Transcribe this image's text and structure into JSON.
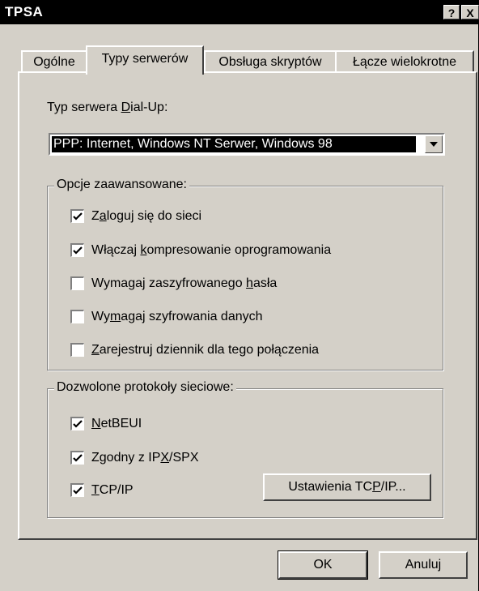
{
  "window": {
    "title": "TPSA",
    "help_label": "?",
    "close_label": "X"
  },
  "tabs": [
    {
      "label": "Ogólne"
    },
    {
      "label": "Typy serwerów"
    },
    {
      "label": "Obsługa skryptów"
    },
    {
      "label": "Łącze wielokrotne"
    }
  ],
  "server_type": {
    "label_pre": "Typ serwera ",
    "label_accel": "D",
    "label_post": "ial-Up:",
    "value": "PPP: Internet, Windows NT Serwer, Windows 98"
  },
  "advanced": {
    "legend": "Opcje zaawansowane:",
    "items": [
      {
        "pre": "Z",
        "accel": "a",
        "post": "loguj się do sieci",
        "checked": true
      },
      {
        "pre": "Włączaj ",
        "accel": "k",
        "post": "ompresowanie oprogramowania",
        "checked": true
      },
      {
        "pre": "Wymagaj zaszyfrowanego ",
        "accel": "h",
        "post": "asła",
        "checked": false
      },
      {
        "pre": "Wy",
        "accel": "m",
        "post": "agaj szyfrowania danych",
        "checked": false
      },
      {
        "pre": "",
        "accel": "Z",
        "post": "arejestruj dziennik dla tego połączenia",
        "checked": false
      }
    ]
  },
  "protocols": {
    "legend": "Dozwolone protokoły sieciowe:",
    "items": [
      {
        "pre": "",
        "accel": "N",
        "post": "etBEUI",
        "checked": true
      },
      {
        "pre": "Zgodny z IP",
        "accel": "X",
        "post": "/SPX",
        "checked": true
      },
      {
        "pre": "",
        "accel": "T",
        "post": "CP/IP",
        "checked": true
      }
    ],
    "tcp_button": {
      "pre": "Ustawienia TC",
      "accel": "P",
      "post": "/IP..."
    }
  },
  "footer": {
    "ok_label": "OK",
    "cancel_label": "Anuluj"
  }
}
